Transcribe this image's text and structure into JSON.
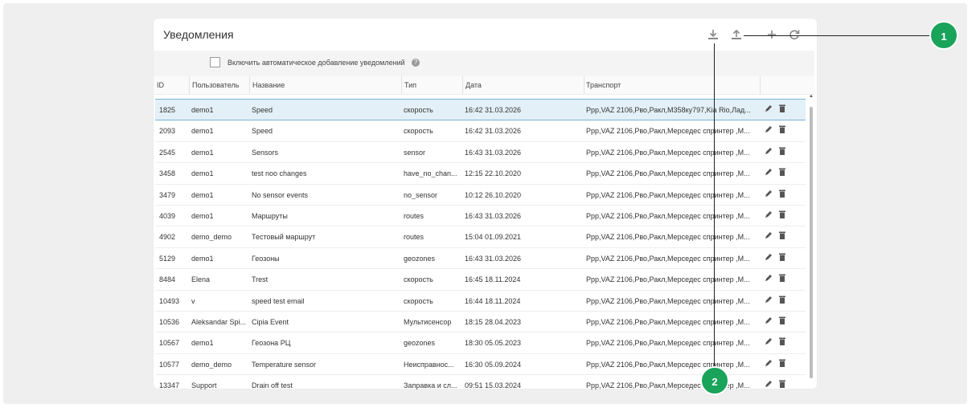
{
  "panel": {
    "title": "Уведомления",
    "auto_add_label": "Включить автоматическое добавление уведомлений",
    "help_glyph": "?"
  },
  "toolbar": {
    "icons": [
      "download-icon",
      "upload-icon",
      "plus-icon",
      "refresh-icon"
    ]
  },
  "columns": {
    "id": "ID",
    "user": "Пользователь",
    "name": "Название",
    "type": "Тип",
    "date": "Дата",
    "transport": "Транспорт"
  },
  "rows": [
    {
      "id": "1825",
      "user": "demo1",
      "name": "Speed",
      "type": "скорость",
      "date": "16:42 31.03.2026",
      "transport": "Ppp,VAZ 2106,Рво,Ракл,М358ку797,Kia Rio,Лад...",
      "selected": true
    },
    {
      "id": "2093",
      "user": "demo1",
      "name": "Speed",
      "type": "скорость",
      "date": "16:42 31.03.2026",
      "transport": "Ppp,VAZ 2106,Рво,Ракл,Мерседес спринтер ,М..."
    },
    {
      "id": "2545",
      "user": "demo1",
      "name": "Sensors",
      "type": "sensor",
      "date": "16:43 31.03.2026",
      "transport": "Ppp,VAZ 2106,Рво,Ракл,Мерседес спринтер ,М..."
    },
    {
      "id": "3458",
      "user": "demo1",
      "name": "test noo changes",
      "type": "have_no_chan...",
      "date": "12:15 22.10.2020",
      "transport": "Ppp,VAZ 2106,Рво,Ракл,Мерседес спринтер ,М..."
    },
    {
      "id": "3479",
      "user": "demo1",
      "name": "No sensor events",
      "type": "no_sensor",
      "date": "10:12 26.10.2020",
      "transport": "Ppp,VAZ 2106,Рво,Ракл,Мерседес спринтер ,М..."
    },
    {
      "id": "4039",
      "user": "demo1",
      "name": "Маршруты",
      "type": "routes",
      "date": "16:43 31.03.2026",
      "transport": "Ppp,VAZ 2106,Рво,Ракл,Мерседес спринтер ,М..."
    },
    {
      "id": "4902",
      "user": "demo_demo",
      "name": "Тестовый маршрут",
      "type": "routes",
      "date": "15:04 01.09.2021",
      "transport": "Ppp,VAZ 2106,Рво,Ракл,Мерседес спринтер ,М..."
    },
    {
      "id": "5129",
      "user": "demo1",
      "name": "Геозоны",
      "type": "geozones",
      "date": "16:43 31.03.2026",
      "transport": "Ppp,VAZ 2106,Рво,Ракл,Мерседес спринтер ,М..."
    },
    {
      "id": "8484",
      "user": "Elena",
      "name": "Trest",
      "type": "скорость",
      "date": "16:45 18.11.2024",
      "transport": "Ppp,VAZ 2106,Рво,Ракл,Мерседес спринтер ,М..."
    },
    {
      "id": "10493",
      "user": "v",
      "name": "speed test email",
      "type": "скорость",
      "date": "16:44 18.11.2024",
      "transport": "Ppp,VAZ 2106,Рво,Ракл,Мерседес спринтер ,М..."
    },
    {
      "id": "10536",
      "user": "Aleksandar Spi...",
      "name": "Cipia Event",
      "type": "Мультисенсор",
      "date": "18:15 28.04.2023",
      "transport": "Ppp,VAZ 2106,Рво,Ракл,Мерседес спринтер ,М..."
    },
    {
      "id": "10567",
      "user": "demo1",
      "name": "Геозона РЦ",
      "type": "geozones",
      "date": "18:30 05.05.2023",
      "transport": "Ppp,VAZ 2106,Рво,Ракл,Мерседес спринтер ,М..."
    },
    {
      "id": "10577",
      "user": "demo_demo",
      "name": "Temperature sensor",
      "type": "Неисправнос...",
      "date": "16:30 05.09.2024",
      "transport": "Ppp,VAZ 2106,Рво,Ракл,Мерседес спринтер ,М..."
    },
    {
      "id": "13347",
      "user": "Support",
      "name": "Drain off test",
      "type": "Заправка и сл...",
      "date": "09:51 15.03.2024",
      "transport": "Ppp,VAZ 2106,Рво,Ракл,Мерседес спринтер ,М..."
    }
  ],
  "callouts": [
    {
      "label": "1",
      "target": "upload-icon"
    },
    {
      "label": "2",
      "target": "download-icon"
    }
  ],
  "colors": {
    "accent": "#1aa35a",
    "selected_row": "#e3f0f7"
  }
}
